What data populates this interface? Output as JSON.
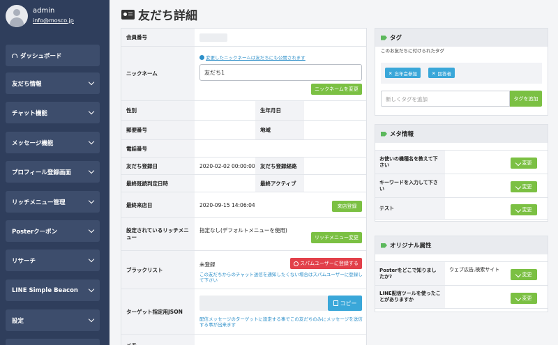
{
  "user": {
    "name": "admin",
    "email": "info@mosco.jp"
  },
  "nav": [
    {
      "label": "ダッシュボード"
    },
    {
      "label": "友だち情報"
    },
    {
      "label": "チャット機能"
    },
    {
      "label": "メッセージ機能"
    },
    {
      "label": "プロフィール登録画面"
    },
    {
      "label": "リッチメニュー管理"
    },
    {
      "label": "Posterクーポン"
    },
    {
      "label": "リサーチ"
    },
    {
      "label": "LINE Simple Beacon"
    },
    {
      "label": "設定"
    }
  ],
  "page": {
    "title": "友だち詳細"
  },
  "detail": {
    "member_no_label": "会員番号",
    "nickname_label": "ニックネーム",
    "nickname_note": "変更したニックネームは友だちにも公開されます",
    "nickname_value": "友だち1",
    "nickname_button": "ニックネームを変更",
    "gender_label": "性別",
    "birthday_label": "生年月日",
    "zip_label": "郵便番号",
    "region_label": "地域",
    "phone_label": "電話番号",
    "reg_date_label": "友だち登録日",
    "reg_date_value": "2020-02-02 00:00:00",
    "reg_route_label": "友だち登録経路",
    "last_read_label": "最終既読判定日時",
    "last_active_label": "最終アクティブ",
    "last_visit_label": "最終来店日",
    "last_visit_value": "2020-09-15 14:06:04",
    "visit_button": "来店登録",
    "rich_menu_label": "設定されているリッチメニュー",
    "rich_menu_value": "指定なし(デフォルトメニューを使用)",
    "rich_menu_button": "リッチメニュー変更",
    "blacklist_label": "ブラックリスト",
    "blacklist_value": "未登録",
    "spam_button": "スパムユーザーに登録する",
    "blacklist_note": "この友だちからのチャット送信を通知したくない場合はスパムユーザーに登録して下さい",
    "target_json_label": "ターゲット指定用JSON",
    "copy_button": "コピー",
    "target_note": "配信メッセージのターゲットに設定する事でこの友だちのみにメッセージを送信する事が出来ます",
    "memo_label": "メモ"
  },
  "tags": {
    "title": "タグ",
    "subtitle": "このお友だちに付けられたタグ",
    "items": [
      "忘年会参加",
      "回答者"
    ],
    "input_placeholder": "新しくタグを追加",
    "add_button": "タグを追加"
  },
  "meta": {
    "title": "メタ情報",
    "rows": [
      {
        "label": "お使いの機種名を教えて下さい",
        "button": "変更"
      },
      {
        "label": "キーワードを入力して下さい",
        "button": "変更"
      },
      {
        "label": "テスト",
        "button": "変更"
      }
    ]
  },
  "original": {
    "title": "オリジナル属性",
    "rows": [
      {
        "label": "Posterをどこで知りましたか?",
        "value": "ウェブ広告,検索サイト",
        "button": "変更"
      },
      {
        "label": "LINE配信ツールを使ったことがありますか",
        "value": "",
        "button": "変更"
      }
    ]
  },
  "colors": {
    "sidebar": "#2f3e5c",
    "green": "#7bc043",
    "red": "#e2404a",
    "blue": "#3aa7d9"
  }
}
